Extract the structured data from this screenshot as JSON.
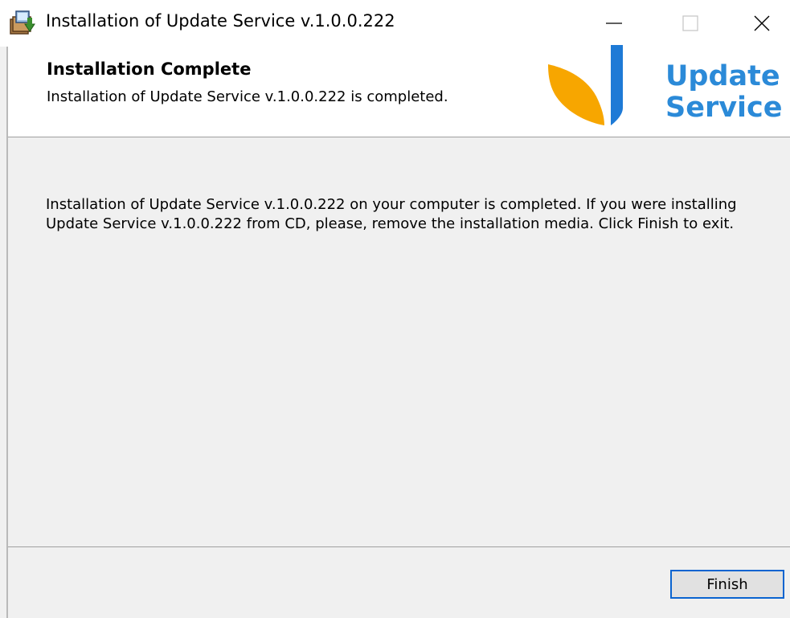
{
  "window": {
    "title": "Installation of Update Service v.1.0.0.222",
    "controls": [
      "minimize-icon",
      "maximize-icon",
      "close-icon"
    ]
  },
  "header": {
    "heading": "Installation Complete",
    "subheading": "Installation of Update Service v.1.0.0.222 is completed.",
    "logo": {
      "line1": "Update",
      "line2": "Service",
      "colors": {
        "leaf": "#f7a600",
        "bar": "#1e7ad6",
        "text": "#2b8ad8"
      }
    }
  },
  "main": {
    "message": "Installation of Update Service v.1.0.0.222 on your computer is completed. If you were installing Update Service v.1.0.0.222 from CD, please, remove the installation media. Click Finish to exit."
  },
  "footer": {
    "finish_label": "Finish"
  }
}
